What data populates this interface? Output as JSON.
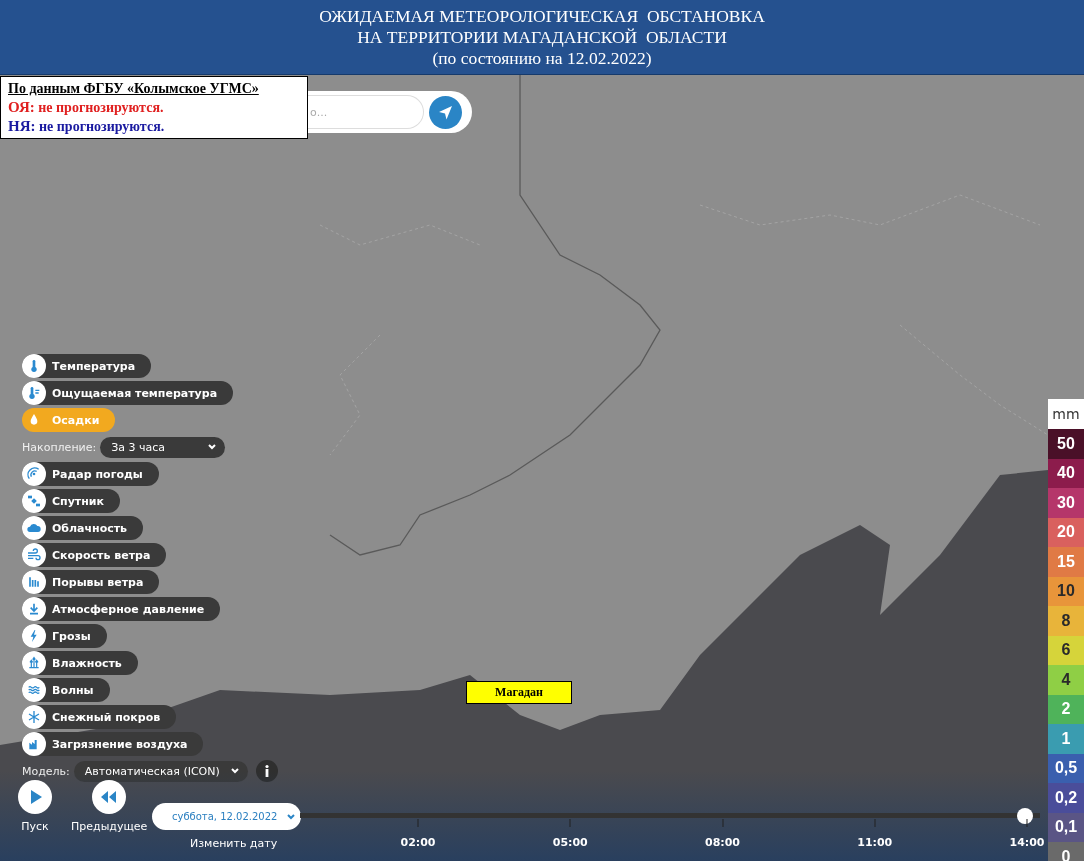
{
  "header": {
    "lines": [
      "ОЖИДАЕМАЯ МЕТЕОРОЛОГИЧЕСКАЯ  ОБСТАНОВКА",
      "НА ТЕРРИТОРИИ МАГАДАНСКОЙ  ОБЛАСТИ",
      "(по состоянию на 12.02.2022)"
    ]
  },
  "info_box": {
    "source": "По данным ФГБУ «Колымское УГМС»",
    "lines": [
      {
        "prefix": "ОЯ:",
        "text": " не прогнозируются.",
        "color": "#e02020"
      },
      {
        "prefix": "НЯ:",
        "text": " не прогнозируются.",
        "color": "#1a1aa0"
      }
    ]
  },
  "search": {
    "placeholder": "о..."
  },
  "layer_panel": [
    {
      "kind": "layer",
      "label": "Температура",
      "selected": false
    },
    {
      "kind": "layer",
      "label": "Ощущаемая температура",
      "selected": false
    },
    {
      "kind": "layer",
      "label": "Осадки",
      "selected": true
    },
    {
      "kind": "select",
      "label": "Накопление:",
      "value": "За 3 часа"
    },
    {
      "kind": "layer",
      "label": "Радар погоды",
      "selected": false
    },
    {
      "kind": "layer",
      "label": "Спутник",
      "selected": false
    },
    {
      "kind": "layer",
      "label": "Облачность",
      "selected": false
    },
    {
      "kind": "layer",
      "label": "Скорость ветра",
      "selected": false
    },
    {
      "kind": "layer",
      "label": "Порывы ветра",
      "selected": false
    },
    {
      "kind": "layer",
      "label": "Атмосферное давление",
      "selected": false
    },
    {
      "kind": "layer",
      "label": "Грозы",
      "selected": false
    },
    {
      "kind": "layer",
      "label": "Влажность",
      "selected": false
    },
    {
      "kind": "layer",
      "label": "Волны",
      "selected": false
    },
    {
      "kind": "layer",
      "label": "Снежный покров",
      "selected": false
    },
    {
      "kind": "layer",
      "label": "Загрязнение воздуха",
      "selected": false
    },
    {
      "kind": "model",
      "label": "Модель:",
      "value": "Автоматическая (ICON)"
    }
  ],
  "city_label": "Магадан",
  "player": {
    "play": "Пуск",
    "previous": "Предыдущее",
    "date": "суббота, 12.02.2022",
    "change_date": "Изменить дату"
  },
  "timeline": {
    "ticks": [
      "02:00",
      "05:00",
      "08:00",
      "11:00",
      "14:00"
    ],
    "level": 0.98
  },
  "legend": {
    "unit": "mm",
    "items": [
      {
        "label": "50",
        "color": "#4a1028"
      },
      {
        "label": "40",
        "color": "#8c1c4c"
      },
      {
        "label": "30",
        "color": "#b5366a"
      },
      {
        "label": "20",
        "color": "#d9605e"
      },
      {
        "label": "15",
        "color": "#e07a45"
      },
      {
        "label": "10",
        "color": "#e8953a"
      },
      {
        "label": "8",
        "color": "#e8b43a"
      },
      {
        "label": "6",
        "color": "#d6d43a"
      },
      {
        "label": "4",
        "color": "#8fcf45"
      },
      {
        "label": "2",
        "color": "#4fb35a"
      },
      {
        "label": "1",
        "color": "#3a9cb0"
      },
      {
        "label": "0,5",
        "color": "#3a5fae"
      },
      {
        "label": "0,2",
        "color": "#4a4d9a"
      },
      {
        "label": "0,1",
        "color": "#5a5585"
      },
      {
        "label": "0",
        "color": "#6a6a6a"
      }
    ]
  }
}
